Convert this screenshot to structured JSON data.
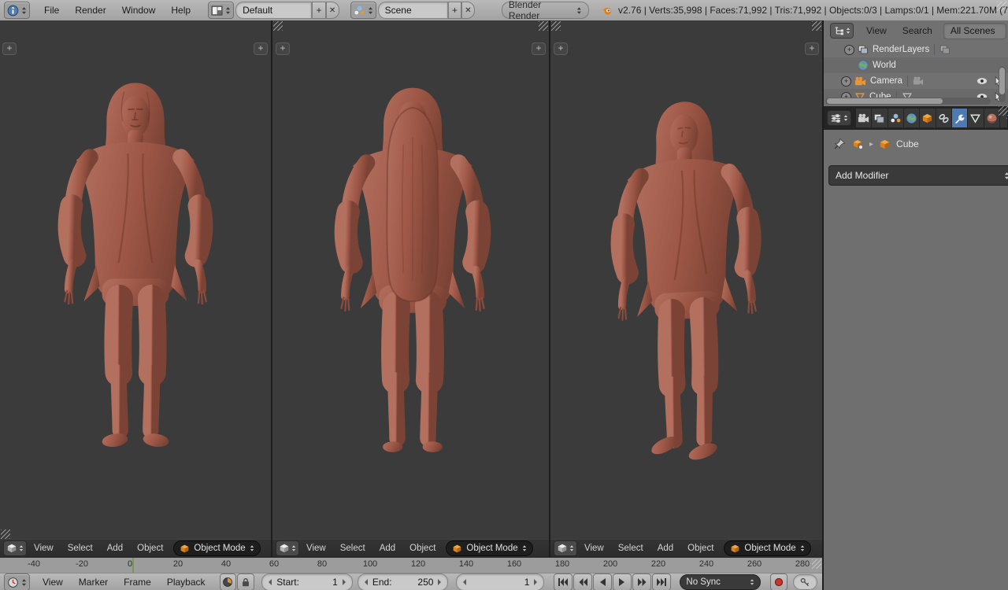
{
  "header": {
    "menus": [
      "File",
      "Render",
      "Window",
      "Help"
    ],
    "layout_value": "Default",
    "scene_value": "Scene",
    "engine": "Blender Render",
    "stats": "v2.76 | Verts:35,998 | Faces:71,992 | Tris:71,992 | Objects:0/3 | Lamps:0/1 | Mem:221.70M (7",
    "add_label": "+",
    "close_label": "✕"
  },
  "viewport": {
    "menus": [
      "View",
      "Select",
      "Add",
      "Object"
    ],
    "mode": "Object Mode",
    "expand_label": "+"
  },
  "outliner": {
    "menus": [
      "View",
      "Search"
    ],
    "filter": "All Scenes",
    "items": [
      {
        "label": "RenderLayers",
        "icon": "renderlayers-icon"
      },
      {
        "label": "World",
        "icon": "world-icon"
      },
      {
        "label": "Camera",
        "icon": "camera-icon"
      },
      {
        "label": "Cube",
        "icon": "mesh-icon"
      }
    ]
  },
  "properties": {
    "tabs": [
      "render",
      "render-layers",
      "scene",
      "world",
      "object",
      "constraints",
      "modifiers",
      "object-data",
      "material",
      "texture"
    ],
    "active_tab": "modifiers",
    "object_name": "Cube",
    "add_modifier_label": "Add Modifier"
  },
  "timeline": {
    "menus": [
      "View",
      "Marker",
      "Frame",
      "Playback"
    ],
    "start_label": "Start:",
    "start_value": "1",
    "end_label": "End:",
    "end_value": "250",
    "frame_value": "1",
    "sync_mode": "No Sync",
    "current_frame": 1,
    "ruler": [
      -40,
      -20,
      0,
      20,
      40,
      60,
      80,
      100,
      120,
      140,
      160,
      180,
      200,
      220,
      240,
      260,
      280
    ]
  },
  "colors": {
    "clay_base": "#a05a4b",
    "clay_light": "#b3705f",
    "clay_dark": "#7b4335",
    "viewport_bg": "#3b3b3b",
    "active_tab_bg": "#4e7ab2",
    "record_red": "#c9342a",
    "frame_line_green": "#6f9a45"
  }
}
